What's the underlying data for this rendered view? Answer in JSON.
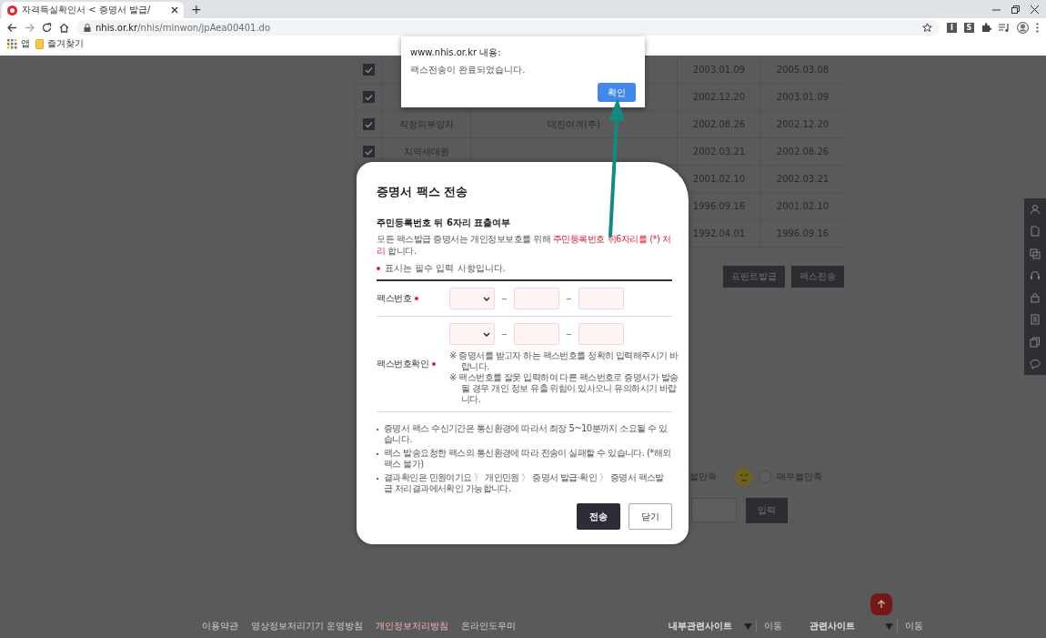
{
  "browser": {
    "tab": {
      "title": "자격득실확인서 < 증명서 발급/",
      "selected": true
    },
    "new_tab": "+",
    "url": {
      "host": "nhis.or.kr",
      "path": "/nhis/minwon/jpAea00401.do"
    },
    "extension_badges": [
      "I",
      "S"
    ],
    "bookmarks": [
      {
        "kind": "apps",
        "label": "앱"
      },
      {
        "kind": "folder",
        "label": "즐겨찾기"
      }
    ]
  },
  "table": {
    "rows": [
      {
        "checked": true,
        "column_4": "2003.01.09",
        "column_5": "2005.03.08"
      },
      {
        "checked": true,
        "column_4": "2002.12.20",
        "column_5": "2003.01.09"
      },
      {
        "checked": true,
        "column_2": "직장피부양자",
        "column_3": "대진여객(주)",
        "column_4": "2002.08.26",
        "column_5": "2002.12.20"
      },
      {
        "checked": true,
        "column_2": "지역세대원",
        "column_4": "2002.03.21",
        "column_5": "2002.08.26"
      },
      {
        "column_4": "2001.02.10",
        "column_5": "2002.03.21"
      },
      {
        "column_4": "1996.09.16",
        "column_5": "2001.02.10"
      },
      {
        "column_4": "1992.04.01",
        "column_5": "1996.09.16"
      }
    ]
  },
  "actions": [
    "프린트발급",
    "팩스전송"
  ],
  "satisfaction_options": [
    {
      "label": "불만족"
    },
    {
      "label": "매우불만족",
      "selected": false
    }
  ],
  "comment": {
    "button": "입력"
  },
  "footer": {
    "links": [
      {
        "label": "이용약관",
        "highlighted": false
      },
      {
        "label": "영상정보처리기기 운영방침",
        "highlighted": false
      },
      {
        "label": "개인정보처리방침",
        "highlighted": true
      },
      {
        "label": "온라인도우미",
        "highlighted": false
      }
    ],
    "site_selects": [
      {
        "label": "내부관련사이트",
        "button": "이동"
      },
      {
        "label": "관련사이트",
        "button": "이동"
      }
    ]
  },
  "fax_modal": {
    "title": "증명서 팩스 전송",
    "section_title": "주민등록번호 뒤 6자리 표출여부",
    "notice": "모든 팩스발급 증명서는 개인정보보호를 위해 **주민등록번호 뒤6자리를 (*) 처리** 합니다.",
    "required_note": "표시는 필수 입력 사항입니다.",
    "fields": [
      {
        "label": "팩스번호",
        "required": true
      },
      {
        "label": "팩스번호확인",
        "required": true,
        "notes": [
          "※ 증명서를 받고자 하는 팩스번호를 정확히 입력해주시기 바랍니다.",
          "※ 팩스번호를 잘못 입력하여 다른 팩스번호로 증명서가 발송될 경우 개인 정보 유출 위험이 있사오니 유의하시기 바랍니다."
        ]
      }
    ],
    "info": [
      "증명서 팩스 수신기간은 통신환경에 따라서 최장 5~10분까지 소요될 수 있습니다.",
      "팩스 발송요청한 팩스의 통신환경에 따라 전송이 실패할 수 있습니다. (*해외팩스 불가)",
      "결과확인은 민원여기요 〉 개인민원 〉 증명서 발급·확인 〉 증명서 팩스발급 처리결과에서확인 가능합니다."
    ],
    "buttons": [
      {
        "label": "전송",
        "kind": "primary"
      },
      {
        "label": "닫기",
        "kind": "secondary"
      }
    ]
  },
  "alert": {
    "origin": "www.nhis.or.kr 내용:",
    "message": "팩스전송이 완료되었습니다.",
    "button": "확인"
  }
}
